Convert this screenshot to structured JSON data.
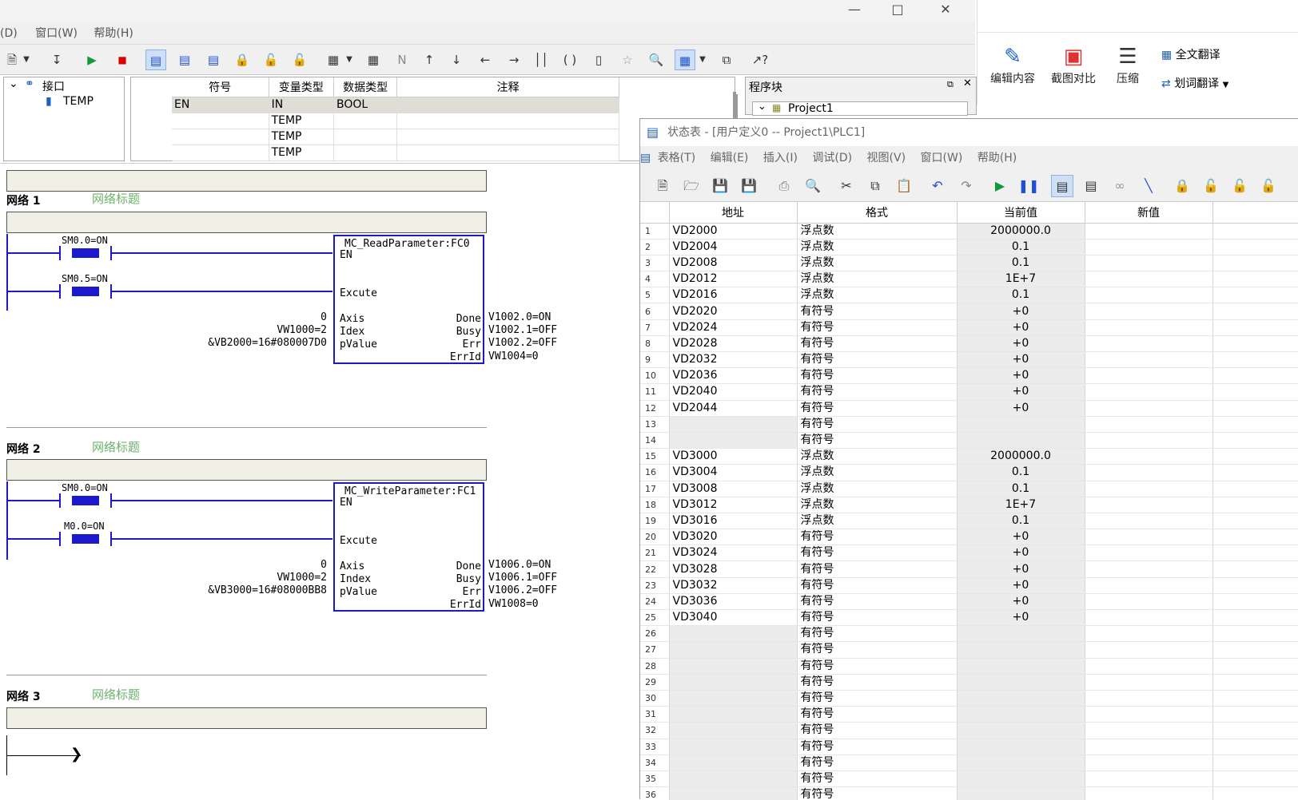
{
  "main_window": {
    "menu": [
      "(D)",
      "窗口(W)",
      "帮助(H)"
    ],
    "mdi_buttons": [
      "_",
      "▫",
      "×"
    ]
  },
  "tree": {
    "root": "接口",
    "child": "TEMP"
  },
  "symbol_table": {
    "headers": [
      "符号",
      "变量类型",
      "数据类型",
      "注释"
    ],
    "rows": [
      {
        "symbol": "EN",
        "var_type": "IN",
        "data_type": "BOOL",
        "comment": ""
      },
      {
        "symbol": "",
        "var_type": "TEMP",
        "data_type": "",
        "comment": ""
      },
      {
        "symbol": "",
        "var_type": "TEMP",
        "data_type": "",
        "comment": ""
      },
      {
        "symbol": "",
        "var_type": "TEMP",
        "data_type": "",
        "comment": ""
      }
    ]
  },
  "program_block": {
    "title": "程序块",
    "project": "Project1"
  },
  "right_panel": {
    "items": [
      "编辑内容",
      "截图对比",
      "压缩",
      "全文翻译",
      "划词翻译"
    ]
  },
  "networks": [
    {
      "label": "网络 1",
      "title": "网络标题",
      "contacts": [
        "SM0.0=ON",
        "SM0.5=ON"
      ],
      "block_name": "MC_ReadParameter:FC0",
      "en": "EN",
      "inputs": [
        {
          "name": "Excute",
          "value": ""
        },
        {
          "name": "Axis",
          "value": "0"
        },
        {
          "name": "Idex",
          "value": "VW1000=2"
        },
        {
          "name": "pValue",
          "value": "&VB2000=16#080007D0"
        }
      ],
      "outputs": [
        {
          "name": "Done",
          "value": "V1002.0=ON"
        },
        {
          "name": "Busy",
          "value": "V1002.1=OFF"
        },
        {
          "name": "Err",
          "value": "V1002.2=OFF"
        },
        {
          "name": "ErrId",
          "value": "VW1004=0"
        }
      ]
    },
    {
      "label": "网络 2",
      "title": "网络标题",
      "contacts": [
        "SM0.0=ON",
        "M0.0=ON"
      ],
      "block_name": "MC_WriteParameter:FC1",
      "en": "EN",
      "inputs": [
        {
          "name": "Excute",
          "value": ""
        },
        {
          "name": "Axis",
          "value": "0"
        },
        {
          "name": "Index",
          "value": "VW1000=2"
        },
        {
          "name": "pValue",
          "value": "&VB3000=16#08000BB8"
        }
      ],
      "outputs": [
        {
          "name": "Done",
          "value": "V1006.0=ON"
        },
        {
          "name": "Busy",
          "value": "V1006.1=OFF"
        },
        {
          "name": "Err",
          "value": "V1006.2=OFF"
        },
        {
          "name": "ErrId",
          "value": "VW1008=0"
        }
      ]
    },
    {
      "label": "网络 3",
      "title": "网络标题"
    }
  ],
  "status_table": {
    "title": "状态表 - [用户定义0 -- Project1\\PLC1]",
    "menu": [
      "表格(T)",
      "编辑(E)",
      "插入(I)",
      "调试(D)",
      "视图(V)",
      "窗口(W)",
      "帮助(H)"
    ],
    "headers": [
      "地址",
      "格式",
      "当前值",
      "新值"
    ],
    "rows": [
      {
        "n": "1",
        "addr": "VD2000",
        "fmt": "浮点数",
        "cur": "2000000.0",
        "new": ""
      },
      {
        "n": "2",
        "addr": "VD2004",
        "fmt": "浮点数",
        "cur": "0.1",
        "new": ""
      },
      {
        "n": "3",
        "addr": "VD2008",
        "fmt": "浮点数",
        "cur": "0.1",
        "new": ""
      },
      {
        "n": "4",
        "addr": "VD2012",
        "fmt": "浮点数",
        "cur": "1E+7",
        "new": ""
      },
      {
        "n": "5",
        "addr": "VD2016",
        "fmt": "浮点数",
        "cur": "0.1",
        "new": ""
      },
      {
        "n": "6",
        "addr": "VD2020",
        "fmt": "有符号",
        "cur": "+0",
        "new": ""
      },
      {
        "n": "7",
        "addr": "VD2024",
        "fmt": "有符号",
        "cur": "+0",
        "new": ""
      },
      {
        "n": "8",
        "addr": "VD2028",
        "fmt": "有符号",
        "cur": "+0",
        "new": ""
      },
      {
        "n": "9",
        "addr": "VD2032",
        "fmt": "有符号",
        "cur": "+0",
        "new": ""
      },
      {
        "n": "10",
        "addr": "VD2036",
        "fmt": "有符号",
        "cur": "+0",
        "new": ""
      },
      {
        "n": "11",
        "addr": "VD2040",
        "fmt": "有符号",
        "cur": "+0",
        "new": ""
      },
      {
        "n": "12",
        "addr": "VD2044",
        "fmt": "有符号",
        "cur": "+0",
        "new": ""
      },
      {
        "n": "13",
        "addr": "",
        "fmt": "有符号",
        "cur": "",
        "new": ""
      },
      {
        "n": "14",
        "addr": "",
        "fmt": "有符号",
        "cur": "",
        "new": ""
      },
      {
        "n": "15",
        "addr": "VD3000",
        "fmt": "浮点数",
        "cur": "2000000.0",
        "new": ""
      },
      {
        "n": "16",
        "addr": "VD3004",
        "fmt": "浮点数",
        "cur": "0.1",
        "new": ""
      },
      {
        "n": "17",
        "addr": "VD3008",
        "fmt": "浮点数",
        "cur": "0.1",
        "new": ""
      },
      {
        "n": "18",
        "addr": "VD3012",
        "fmt": "浮点数",
        "cur": "1E+7",
        "new": ""
      },
      {
        "n": "19",
        "addr": "VD3016",
        "fmt": "浮点数",
        "cur": "0.1",
        "new": ""
      },
      {
        "n": "20",
        "addr": "VD3020",
        "fmt": "有符号",
        "cur": "+0",
        "new": ""
      },
      {
        "n": "21",
        "addr": "VD3024",
        "fmt": "有符号",
        "cur": "+0",
        "new": ""
      },
      {
        "n": "22",
        "addr": "VD3028",
        "fmt": "有符号",
        "cur": "+0",
        "new": ""
      },
      {
        "n": "23",
        "addr": "VD3032",
        "fmt": "有符号",
        "cur": "+0",
        "new": ""
      },
      {
        "n": "24",
        "addr": "VD3036",
        "fmt": "有符号",
        "cur": "+0",
        "new": ""
      },
      {
        "n": "25",
        "addr": "VD3040",
        "fmt": "有符号",
        "cur": "+0",
        "new": ""
      },
      {
        "n": "26",
        "addr": "",
        "fmt": "有符号",
        "cur": "",
        "new": ""
      },
      {
        "n": "27",
        "addr": "",
        "fmt": "有符号",
        "cur": "",
        "new": ""
      },
      {
        "n": "28",
        "addr": "",
        "fmt": "有符号",
        "cur": "",
        "new": ""
      },
      {
        "n": "29",
        "addr": "",
        "fmt": "有符号",
        "cur": "",
        "new": ""
      },
      {
        "n": "30",
        "addr": "",
        "fmt": "有符号",
        "cur": "",
        "new": ""
      },
      {
        "n": "31",
        "addr": "",
        "fmt": "有符号",
        "cur": "",
        "new": ""
      },
      {
        "n": "32",
        "addr": "",
        "fmt": "有符号",
        "cur": "",
        "new": ""
      },
      {
        "n": "33",
        "addr": "",
        "fmt": "有符号",
        "cur": "",
        "new": ""
      },
      {
        "n": "34",
        "addr": "",
        "fmt": "有符号",
        "cur": "",
        "new": ""
      },
      {
        "n": "35",
        "addr": "",
        "fmt": "有符号",
        "cur": "",
        "new": ""
      },
      {
        "n": "36",
        "addr": "",
        "fmt": "有符号",
        "cur": "",
        "new": ""
      }
    ]
  }
}
